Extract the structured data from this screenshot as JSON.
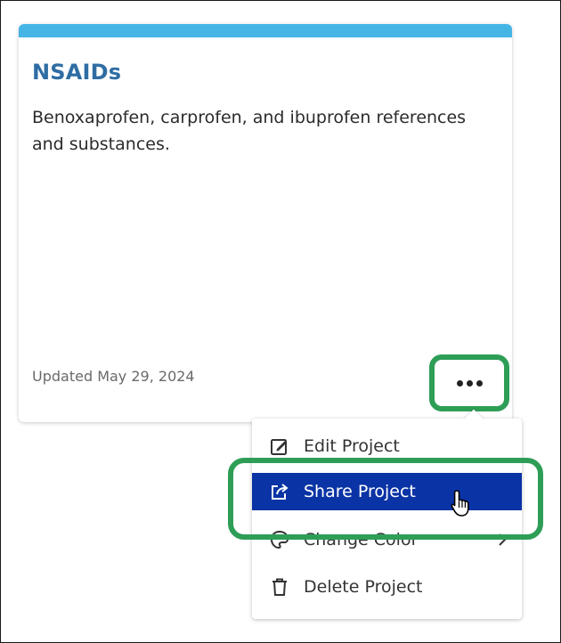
{
  "card": {
    "title": "NSAIDs",
    "description": "Benoxaprofen, carprofen, and ibuprofen references and substances.",
    "updated": "Updated May 29, 2024",
    "accent_color": "#45b5e6",
    "title_color": "#2e6da4",
    "more_icon": "more-horizontal-icon"
  },
  "menu": {
    "items": [
      {
        "label": "Edit Project",
        "icon": "edit-icon"
      },
      {
        "label": "Share Project",
        "icon": "share-icon",
        "selected": true
      },
      {
        "label": "Change Color",
        "icon": "palette-icon",
        "has_submenu": true
      },
      {
        "label": "Delete Project",
        "icon": "trash-icon"
      }
    ],
    "selected_color": "#0a33a5"
  },
  "highlight_color": "#2e9e57"
}
